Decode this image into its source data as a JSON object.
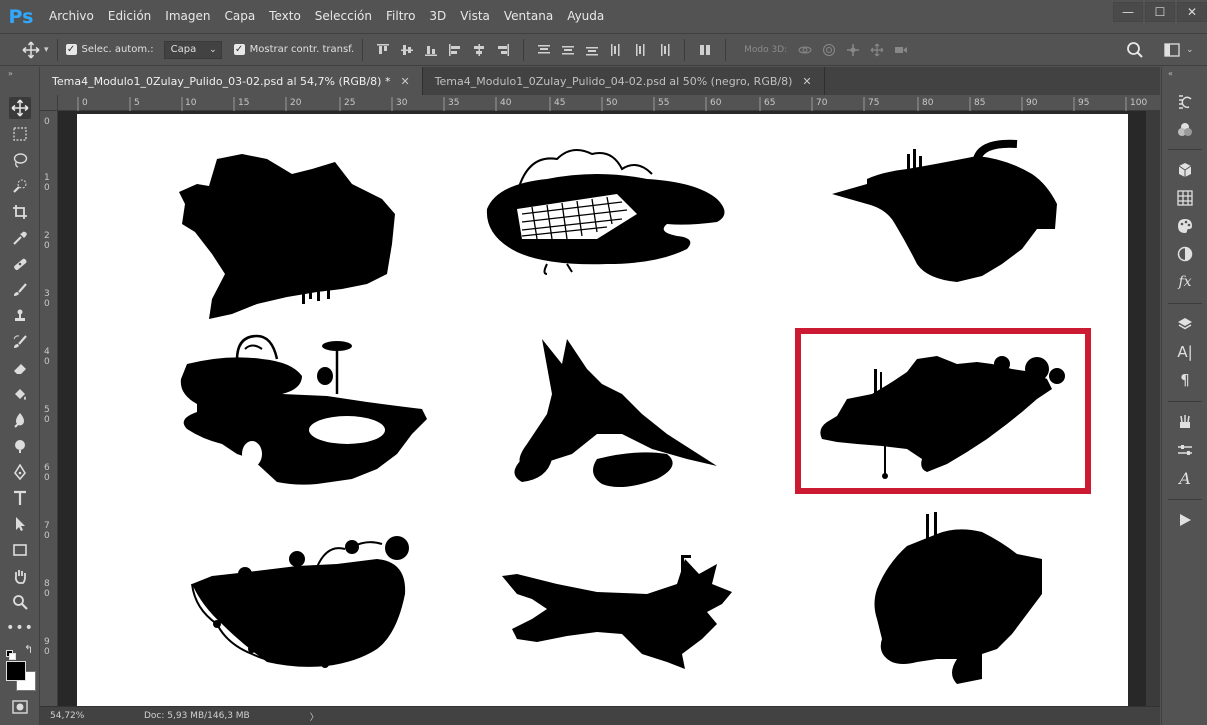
{
  "app": {
    "logo": "Ps"
  },
  "menu": [
    "Archivo",
    "Edición",
    "Imagen",
    "Capa",
    "Texto",
    "Selección",
    "Filtro",
    "3D",
    "Vista",
    "Ventana",
    "Ayuda"
  ],
  "window_controls": {
    "minimize": "—",
    "restore": "☐",
    "close": "✕"
  },
  "options": {
    "auto_select_label": "Selec. autom.:",
    "auto_select_value": "Capa",
    "transform_label": "Mostrar contr. transf.",
    "mode3d_label": "Modo 3D:"
  },
  "tabs": [
    {
      "title": "Tema4_Modulo1_0Zulay_Pulido_03-02.psd al 54,7% (RGB/8) *",
      "close": "✕"
    },
    {
      "title": "Tema4_Modulo1_0Zulay_Pulido_04-02.psd al 50% (negro, RGB/8)",
      "close": "✕"
    }
  ],
  "ruler_top": [
    "0",
    "5",
    "10",
    "15",
    "20",
    "25",
    "30",
    "35",
    "40",
    "45",
    "50",
    "55",
    "60",
    "65",
    "70",
    "75",
    "80",
    "85",
    "90",
    "95",
    "100"
  ],
  "ruler_left": [
    "0",
    "1 0",
    "2 0",
    "3 0",
    "4 0",
    "5 0",
    "6 0",
    "7 0",
    "8 0",
    "9 0"
  ],
  "status": {
    "zoom": "54,72%",
    "doc": "Doc: 5,93 MB/146,3 MB",
    "arrow": "〉"
  },
  "colors": {
    "highlight": "#cc1a33",
    "foreground": "#000000",
    "background": "#ffffff"
  },
  "icons": {
    "move": "move-icon",
    "marquee": "marquee-icon",
    "lasso": "lasso-icon",
    "quick-select": "quick-select-icon",
    "crop": "crop-icon",
    "eyedropper": "eyedropper-icon",
    "healing": "healing-brush-icon",
    "brush": "brush-icon",
    "stamp": "clone-stamp-icon",
    "history-brush": "history-brush-icon",
    "eraser": "eraser-icon",
    "bucket": "paint-bucket-icon",
    "blur": "blur-icon",
    "dodge": "dodge-icon",
    "pen": "pen-icon",
    "type": "type-icon",
    "path-select": "path-select-icon",
    "rectangle": "rectangle-icon",
    "hand": "hand-icon",
    "zoom": "zoom-icon",
    "more": "more-icon"
  }
}
